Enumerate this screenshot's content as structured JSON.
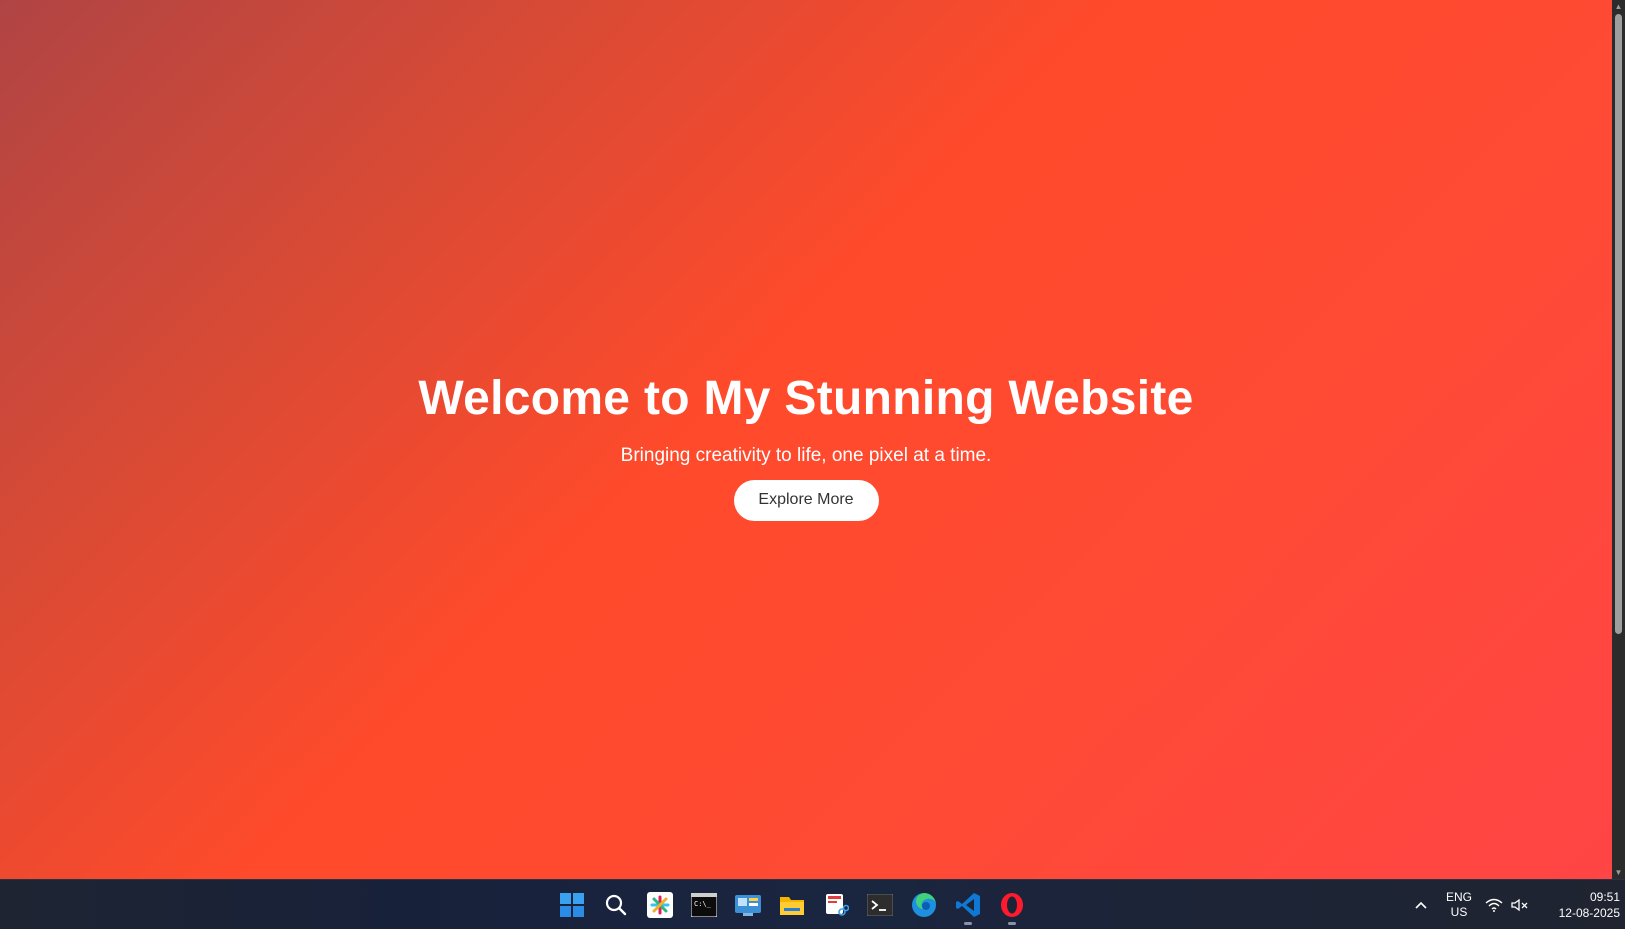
{
  "hero": {
    "title": "Welcome to My Stunning Website",
    "subtitle": "Bringing creativity to life, one pixel at a time.",
    "cta_label": "Explore More"
  },
  "colors": {
    "gradient_start": "#b04444",
    "gradient_mid": "#ff4a2b",
    "gradient_end": "#ff4545",
    "button_bg": "#ffffff",
    "button_text": "#333333",
    "taskbar_bg": "#1c2436"
  },
  "taskbar": {
    "icons": [
      {
        "name": "windows-start-icon",
        "running": false
      },
      {
        "name": "search-icon",
        "running": false
      },
      {
        "name": "slack-icon",
        "running": false
      },
      {
        "name": "command-prompt-icon",
        "running": false
      },
      {
        "name": "control-panel-icon",
        "running": false
      },
      {
        "name": "file-explorer-icon",
        "running": false
      },
      {
        "name": "snipping-tool-icon",
        "running": false
      },
      {
        "name": "terminal-icon",
        "running": false
      },
      {
        "name": "edge-icon",
        "running": false
      },
      {
        "name": "vscode-icon",
        "running": true
      },
      {
        "name": "opera-icon",
        "running": true
      }
    ],
    "tray": {
      "language_line1": "ENG",
      "language_line2": "US",
      "time": "09:51",
      "date": "12-08-2025"
    }
  }
}
